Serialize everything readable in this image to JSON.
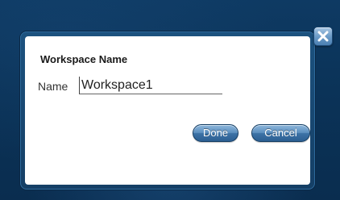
{
  "dialog": {
    "title": "Workspace Name",
    "name_label": "Name",
    "name_value": "Workspace1",
    "done_label": "Done",
    "cancel_label": "Cancel",
    "close_icon": "close-icon"
  },
  "colors": {
    "background": "#0b3358",
    "frame": "#1c527f",
    "panel": "#ffffff",
    "button": "#3d73a6"
  }
}
